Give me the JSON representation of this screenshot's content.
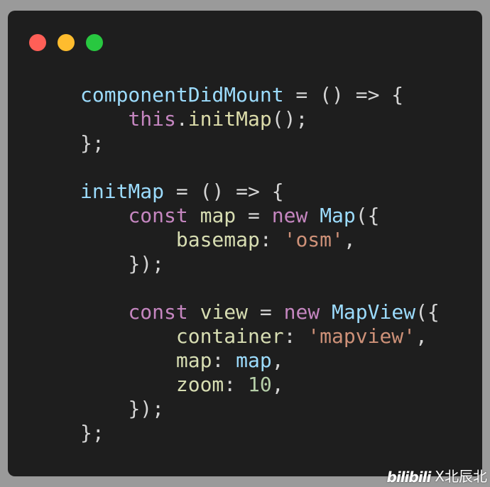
{
  "colors": {
    "red": "#ff5f57",
    "yellow": "#febc2e",
    "green": "#28c840",
    "keyword": "#c586c0",
    "identifier": "#9cdcfe",
    "type": "#4ec9b0",
    "method": "#dcdcaa",
    "string": "#ce9178",
    "number": "#b5cea8",
    "punct": "#d4d4d4",
    "property": "#d7ddb2"
  },
  "code": {
    "lines": [
      {
        "tokens": [
          {
            "t": "componentDidMount",
            "c": "identifier"
          },
          {
            "t": " = () => {",
            "c": "punct"
          }
        ]
      },
      {
        "tokens": [
          {
            "t": "    ",
            "c": "punct"
          },
          {
            "t": "this",
            "c": "keyword"
          },
          {
            "t": ".",
            "c": "punct"
          },
          {
            "t": "initMap",
            "c": "method"
          },
          {
            "t": "();",
            "c": "punct"
          }
        ]
      },
      {
        "tokens": [
          {
            "t": "};",
            "c": "punct"
          }
        ]
      },
      {
        "tokens": []
      },
      {
        "tokens": [
          {
            "t": "initMap",
            "c": "identifier"
          },
          {
            "t": " = () => {",
            "c": "punct"
          }
        ]
      },
      {
        "tokens": [
          {
            "t": "    ",
            "c": "punct"
          },
          {
            "t": "const",
            "c": "keyword"
          },
          {
            "t": " ",
            "c": "punct"
          },
          {
            "t": "map",
            "c": "property"
          },
          {
            "t": " = ",
            "c": "punct"
          },
          {
            "t": "new",
            "c": "keyword"
          },
          {
            "t": " ",
            "c": "punct"
          },
          {
            "t": "Map",
            "c": "identifier"
          },
          {
            "t": "({",
            "c": "punct"
          }
        ]
      },
      {
        "tokens": [
          {
            "t": "        ",
            "c": "punct"
          },
          {
            "t": "basemap",
            "c": "property"
          },
          {
            "t": ": ",
            "c": "punct"
          },
          {
            "t": "'osm'",
            "c": "string"
          },
          {
            "t": ",",
            "c": "punct"
          }
        ]
      },
      {
        "tokens": [
          {
            "t": "    ",
            "c": "punct"
          },
          {
            "t": "});",
            "c": "punct"
          }
        ]
      },
      {
        "tokens": []
      },
      {
        "tokens": [
          {
            "t": "    ",
            "c": "punct"
          },
          {
            "t": "const",
            "c": "keyword"
          },
          {
            "t": " ",
            "c": "punct"
          },
          {
            "t": "view",
            "c": "property"
          },
          {
            "t": " = ",
            "c": "punct"
          },
          {
            "t": "new",
            "c": "keyword"
          },
          {
            "t": " ",
            "c": "punct"
          },
          {
            "t": "MapView",
            "c": "identifier"
          },
          {
            "t": "({",
            "c": "punct"
          }
        ]
      },
      {
        "tokens": [
          {
            "t": "        ",
            "c": "punct"
          },
          {
            "t": "container",
            "c": "property"
          },
          {
            "t": ": ",
            "c": "punct"
          },
          {
            "t": "'mapview'",
            "c": "string"
          },
          {
            "t": ",",
            "c": "punct"
          }
        ]
      },
      {
        "tokens": [
          {
            "t": "        ",
            "c": "punct"
          },
          {
            "t": "map",
            "c": "property"
          },
          {
            "t": ": ",
            "c": "punct"
          },
          {
            "t": "map",
            "c": "identifier"
          },
          {
            "t": ",",
            "c": "punct"
          }
        ]
      },
      {
        "tokens": [
          {
            "t": "        ",
            "c": "punct"
          },
          {
            "t": "zoom",
            "c": "property"
          },
          {
            "t": ": ",
            "c": "punct"
          },
          {
            "t": "10",
            "c": "number"
          },
          {
            "t": ",",
            "c": "punct"
          }
        ]
      },
      {
        "tokens": [
          {
            "t": "    ",
            "c": "punct"
          },
          {
            "t": "});",
            "c": "punct"
          }
        ]
      },
      {
        "tokens": [
          {
            "t": "};",
            "c": "punct"
          }
        ]
      }
    ]
  },
  "watermark": {
    "logo": "bilibili",
    "text": "X北辰北"
  }
}
